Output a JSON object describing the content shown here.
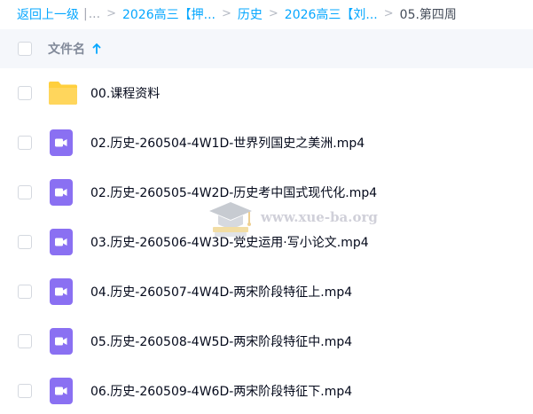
{
  "breadcrumb": {
    "back_label": "返回上一级",
    "divider": "|",
    "ellipsis": "...",
    "separator": ">",
    "items": [
      "2026高三【押...",
      "历史",
      "2026高三【刘..."
    ],
    "current": "05.第四周"
  },
  "header": {
    "column_label": "文件名",
    "sort": "ascending"
  },
  "files": [
    {
      "name": "00.课程资料",
      "icon": "folder-icon"
    },
    {
      "name": "02.历史-260504-4W1D-世界列国史之美洲.mp4",
      "icon": "video-icon"
    },
    {
      "name": "02.历史-260505-4W2D-历史考中国式现代化.mp4",
      "icon": "video-icon"
    },
    {
      "name": "03.历史-260506-4W3D-党史运用·写小论文.mp4",
      "icon": "video-icon"
    },
    {
      "name": "04.历史-260507-4W4D-两宋阶段特征上.mp4",
      "icon": "video-icon"
    },
    {
      "name": "05.历史-260508-4W5D-两宋阶段特征中.mp4",
      "icon": "video-icon"
    },
    {
      "name": "06.历史-260509-4W6D-两宋阶段特征下.mp4",
      "icon": "video-icon"
    }
  ],
  "watermark": {
    "text": "www.xue-ba.org"
  },
  "colors": {
    "link": "#06a7ff",
    "folder": "#ffcf3d",
    "video": "#8a70f2",
    "header_bg": "#f5f7fb",
    "text": "#03081a"
  }
}
